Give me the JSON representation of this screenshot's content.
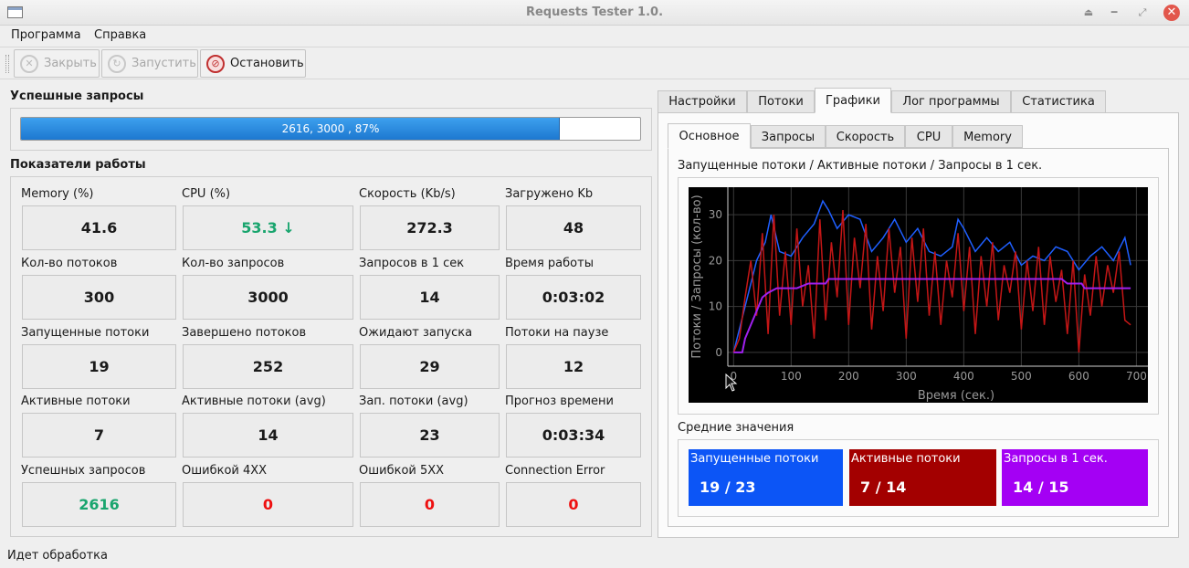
{
  "window": {
    "title": "Requests Tester 1.0."
  },
  "menu": [
    "Программа",
    "Справка"
  ],
  "toolbar": {
    "close_label": "Закрыть",
    "start_label": "Запустить",
    "stop_label": "Остановить"
  },
  "success": {
    "title": "Успешные запросы",
    "progress_text": "2616, 3000 , 87%",
    "progress_fraction": 0.87
  },
  "metrics_title": "Показатели работы",
  "metrics": [
    {
      "label": "Memory (%)",
      "value": "41.6",
      "color": "default"
    },
    {
      "label": "CPU (%)",
      "value": "53.3 ↓",
      "color": "green"
    },
    {
      "label": "Скорость (Kb/s)",
      "value": "272.3",
      "color": "default"
    },
    {
      "label": "Загружено Kb",
      "value": "48",
      "color": "default"
    },
    {
      "label": "Кол-во потоков",
      "value": "300",
      "color": "default"
    },
    {
      "label": "Кол-во запросов",
      "value": "3000",
      "color": "default"
    },
    {
      "label": "Запросов в 1 сек",
      "value": "14",
      "color": "default"
    },
    {
      "label": "Время работы",
      "value": "0:03:02",
      "color": "default"
    },
    {
      "label": "Запущенные потоки",
      "value": "19",
      "color": "default"
    },
    {
      "label": "Завершено потоков",
      "value": "252",
      "color": "default"
    },
    {
      "label": "Ожидают запуска",
      "value": "29",
      "color": "default"
    },
    {
      "label": "Потоки на паузе",
      "value": "12",
      "color": "default"
    },
    {
      "label": "Активные потоки",
      "value": "7",
      "color": "default"
    },
    {
      "label": "Активные потоки (avg)",
      "value": "14",
      "color": "default"
    },
    {
      "label": "Зап. потоки (avg)",
      "value": "23",
      "color": "default"
    },
    {
      "label": "Прогноз времени",
      "value": "0:03:34",
      "color": "default"
    },
    {
      "label": "Успешных запросов",
      "value": "2616",
      "color": "green"
    },
    {
      "label": "Ошибкой 4XX",
      "value": "0",
      "color": "red"
    },
    {
      "label": "Ошибкой 5XX",
      "value": "0",
      "color": "red"
    },
    {
      "label": "Connection Error",
      "value": "0",
      "color": "red"
    }
  ],
  "tabs": [
    "Настройки",
    "Потоки",
    "Графики",
    "Лог программы",
    "Статистика"
  ],
  "active_tab": "Графики",
  "subtabs": [
    "Основное",
    "Запросы",
    "Скорость",
    "CPU",
    "Memory"
  ],
  "active_subtab": "Основное",
  "chart_title": "Запущенные потоки / Активные потоки / Запросы в 1 сек.",
  "chart_data": {
    "type": "line",
    "xlabel": "Время (сек.)",
    "ylabel": "Потоки / Запросы (кол-во)",
    "xlim": [
      -10,
      720
    ],
    "ylim": [
      -3,
      36
    ],
    "x_ticks": [
      0,
      100,
      200,
      300,
      400,
      500,
      600,
      700
    ],
    "y_ticks": [
      0,
      10,
      20,
      30
    ],
    "grid": true,
    "legend": "none",
    "series": [
      {
        "color": "#1f5fff",
        "points": [
          [
            0,
            0
          ],
          [
            20,
            10
          ],
          [
            40,
            20
          ],
          [
            55,
            24
          ],
          [
            65,
            30
          ],
          [
            80,
            22
          ],
          [
            100,
            21
          ],
          [
            120,
            25
          ],
          [
            140,
            28
          ],
          [
            155,
            33
          ],
          [
            165,
            31
          ],
          [
            180,
            27
          ],
          [
            200,
            30
          ],
          [
            220,
            29
          ],
          [
            240,
            22
          ],
          [
            260,
            25
          ],
          [
            280,
            29
          ],
          [
            300,
            24
          ],
          [
            320,
            27
          ],
          [
            340,
            22
          ],
          [
            360,
            21
          ],
          [
            380,
            23
          ],
          [
            390,
            29
          ],
          [
            400,
            27
          ],
          [
            420,
            22
          ],
          [
            440,
            25
          ],
          [
            460,
            22
          ],
          [
            480,
            24
          ],
          [
            500,
            19
          ],
          [
            520,
            21
          ],
          [
            540,
            20
          ],
          [
            560,
            23
          ],
          [
            580,
            22
          ],
          [
            600,
            18
          ],
          [
            620,
            21
          ],
          [
            640,
            23
          ],
          [
            660,
            20
          ],
          [
            680,
            25
          ],
          [
            690,
            19
          ]
        ]
      },
      {
        "color": "#c41616",
        "points": [
          [
            0,
            0
          ],
          [
            10,
            3
          ],
          [
            20,
            12
          ],
          [
            30,
            20
          ],
          [
            40,
            8
          ],
          [
            50,
            26
          ],
          [
            60,
            4
          ],
          [
            70,
            30
          ],
          [
            80,
            8
          ],
          [
            90,
            22
          ],
          [
            100,
            6
          ],
          [
            110,
            27
          ],
          [
            120,
            10
          ],
          [
            130,
            19
          ],
          [
            140,
            3
          ],
          [
            150,
            29
          ],
          [
            160,
            7
          ],
          [
            170,
            24
          ],
          [
            180,
            12
          ],
          [
            190,
            31
          ],
          [
            200,
            6
          ],
          [
            210,
            25
          ],
          [
            220,
            14
          ],
          [
            230,
            28
          ],
          [
            240,
            5
          ],
          [
            250,
            21
          ],
          [
            260,
            9
          ],
          [
            270,
            27
          ],
          [
            280,
            13
          ],
          [
            290,
            23
          ],
          [
            300,
            3
          ],
          [
            310,
            25
          ],
          [
            320,
            11
          ],
          [
            330,
            27
          ],
          [
            340,
            8
          ],
          [
            350,
            22
          ],
          [
            360,
            6
          ],
          [
            370,
            20
          ],
          [
            380,
            12
          ],
          [
            390,
            26
          ],
          [
            400,
            9
          ],
          [
            410,
            23
          ],
          [
            420,
            4
          ],
          [
            430,
            21
          ],
          [
            440,
            10
          ],
          [
            450,
            24
          ],
          [
            460,
            7
          ],
          [
            470,
            19
          ],
          [
            480,
            13
          ],
          [
            490,
            22
          ],
          [
            500,
            5
          ],
          [
            510,
            20
          ],
          [
            520,
            9
          ],
          [
            530,
            23
          ],
          [
            540,
            6
          ],
          [
            550,
            21
          ],
          [
            560,
            11
          ],
          [
            570,
            18
          ],
          [
            580,
            4
          ],
          [
            590,
            20
          ],
          [
            600,
            0
          ],
          [
            610,
            17
          ],
          [
            620,
            8
          ],
          [
            630,
            21
          ],
          [
            640,
            10
          ],
          [
            650,
            19
          ],
          [
            660,
            13
          ],
          [
            670,
            22
          ],
          [
            680,
            7
          ],
          [
            690,
            6
          ]
        ]
      },
      {
        "color": "#a020f0",
        "points": [
          [
            0,
            0
          ],
          [
            15,
            0
          ],
          [
            20,
            3
          ],
          [
            30,
            6
          ],
          [
            40,
            9
          ],
          [
            50,
            12
          ],
          [
            60,
            13
          ],
          [
            75,
            14
          ],
          [
            110,
            14
          ],
          [
            130,
            15
          ],
          [
            160,
            15
          ],
          [
            165,
            16
          ],
          [
            540,
            16
          ],
          [
            570,
            16
          ],
          [
            580,
            15
          ],
          [
            605,
            15
          ],
          [
            610,
            14
          ],
          [
            690,
            14
          ]
        ]
      }
    ]
  },
  "averages_title": "Средние значения",
  "averages": [
    {
      "label": "Запущенные потоки",
      "value": "19 / 23",
      "color": "#0c55f6"
    },
    {
      "label": "Активные потоки",
      "value": "7 / 14",
      "color": "#a30000"
    },
    {
      "label": "Запросы в 1 сек.",
      "value": "14 / 15",
      "color": "#a400f4"
    }
  ],
  "status": "Идет обработка"
}
